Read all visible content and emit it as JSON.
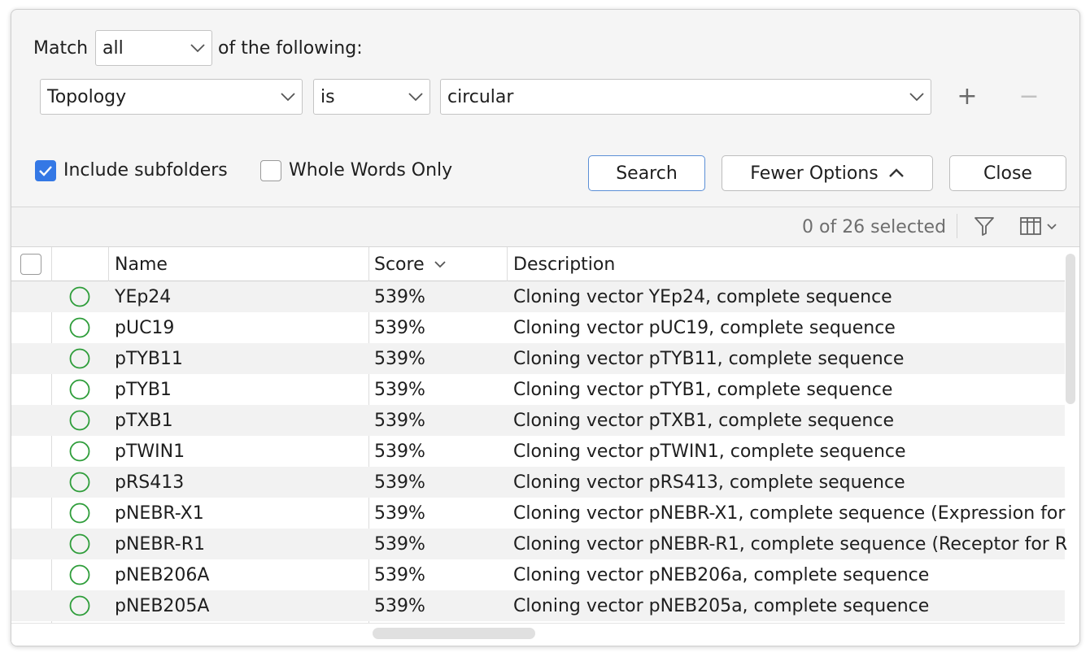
{
  "criteria": {
    "match_label": "Match",
    "match_value": "all",
    "match_suffix": "of the following:",
    "field": "Topology",
    "operator": "is",
    "value": "circular",
    "add_symbol": "+",
    "remove_symbol": "−"
  },
  "options": {
    "include_subfolders_label": "Include subfolders",
    "include_subfolders_checked": true,
    "whole_words_label": "Whole Words Only",
    "whole_words_checked": false
  },
  "buttons": {
    "search": "Search",
    "fewer_options": "Fewer Options",
    "close": "Close"
  },
  "results": {
    "selection_status": "0 of 26 selected",
    "columns": {
      "name": "Name",
      "score": "Score",
      "description": "Description"
    },
    "rows": [
      {
        "name": "YEp24",
        "score": "539%",
        "description": "Cloning vector YEp24, complete sequence"
      },
      {
        "name": "pUC19",
        "score": "539%",
        "description": "Cloning vector pUC19, complete sequence"
      },
      {
        "name": "pTYB11",
        "score": "539%",
        "description": "Cloning vector pTYB11, complete sequence"
      },
      {
        "name": "pTYB1",
        "score": "539%",
        "description": "Cloning vector pTYB1, complete sequence"
      },
      {
        "name": "pTXB1",
        "score": "539%",
        "description": "Cloning vector pTXB1, complete sequence"
      },
      {
        "name": "pTWIN1",
        "score": "539%",
        "description": "Cloning vector pTWIN1, complete sequence"
      },
      {
        "name": "pRS413",
        "score": "539%",
        "description": "Cloning vector pRS413, complete sequence"
      },
      {
        "name": "pNEBR-X1",
        "score": "539%",
        "description": "Cloning vector pNEBR-X1, complete sequence (Expression for"
      },
      {
        "name": "pNEBR-R1",
        "score": "539%",
        "description": "Cloning vector pNEBR-R1, complete sequence (Receptor for R"
      },
      {
        "name": "pNEB206A",
        "score": "539%",
        "description": "Cloning vector pNEB206a, complete sequence"
      },
      {
        "name": "pNEB205A",
        "score": "539%",
        "description": "Cloning vector pNEB205a, complete sequence"
      }
    ]
  },
  "colors": {
    "accent": "#3478e5",
    "circular_icon": "#2e9d3a",
    "primary_button_border": "#5b8fd6"
  },
  "icons": {
    "row_type": "circular-sequence-icon",
    "filter": "filter-icon",
    "columns": "columns-icon",
    "sort": "chevron-down-icon"
  }
}
